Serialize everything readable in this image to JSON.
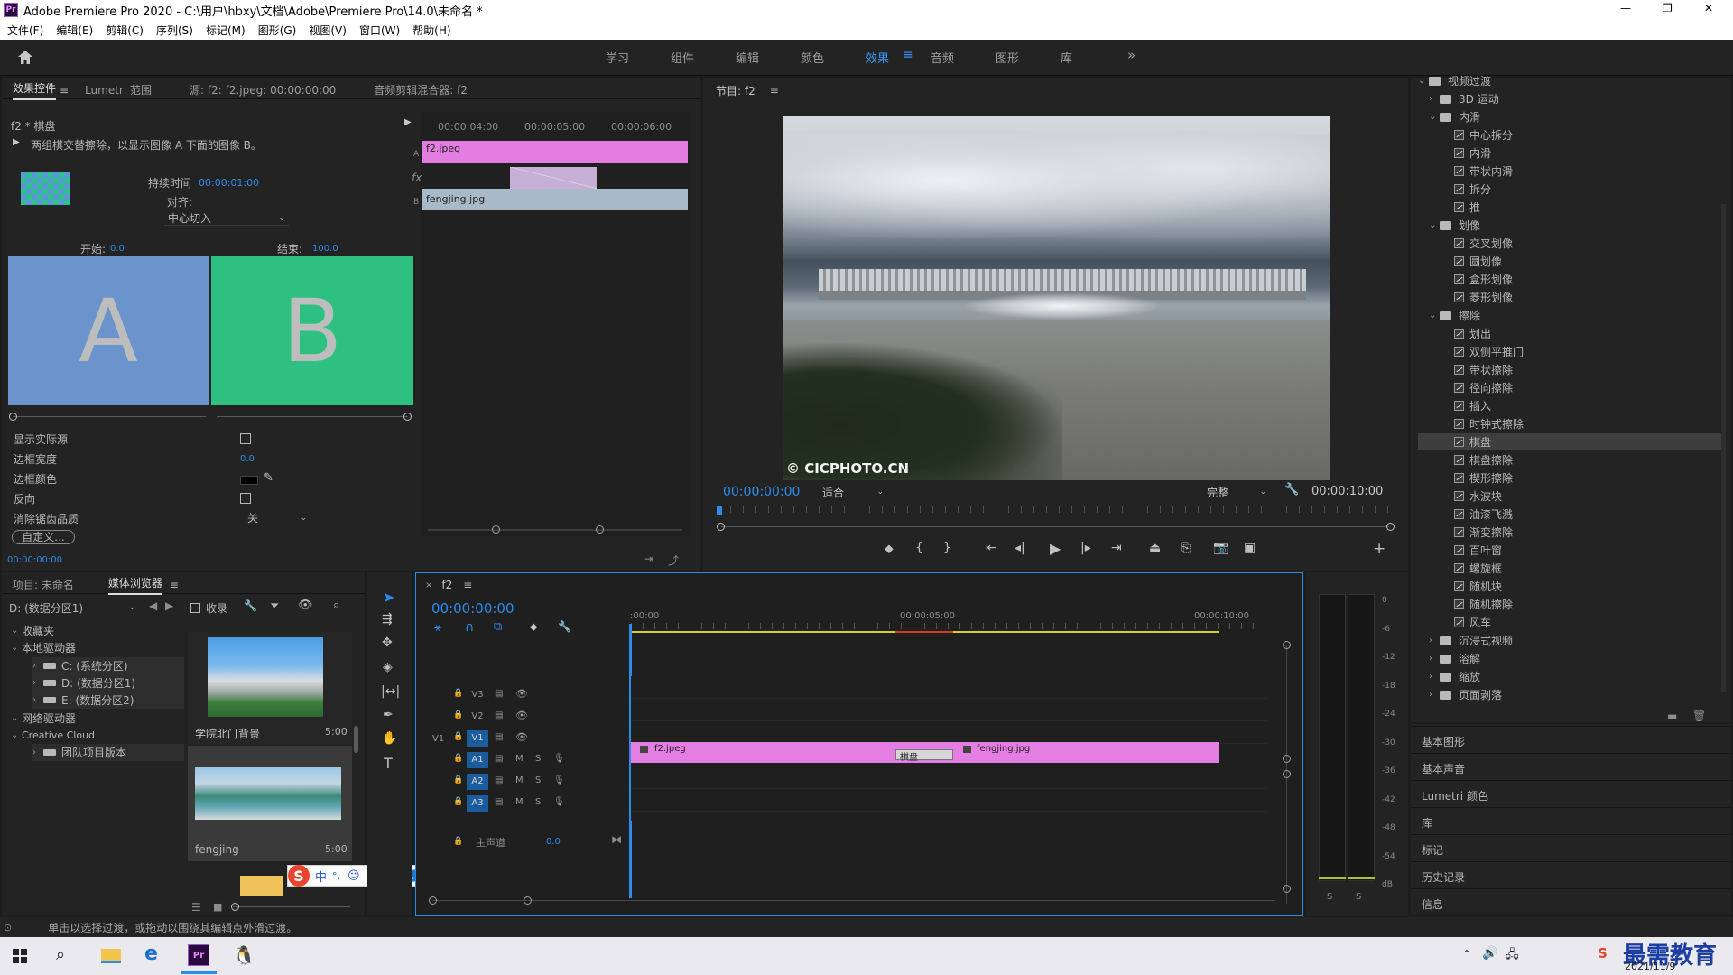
{
  "window": {
    "title": "Adobe Premiere Pro 2020 - C:\\用户\\hbxy\\文档\\Adobe\\Premiere Pro\\14.0\\未命名 *",
    "app_icon": "Pr",
    "controls": [
      "—",
      "❐",
      "✕"
    ]
  },
  "menu": [
    "文件(F)",
    "编辑(E)",
    "剪辑(C)",
    "序列(S)",
    "标记(M)",
    "图形(G)",
    "视图(V)",
    "窗口(W)",
    "帮助(H)"
  ],
  "workspaces": {
    "items": [
      "学习",
      "组件",
      "编辑",
      "颜色",
      "效果",
      "音频",
      "图形",
      "库"
    ],
    "active": "效果",
    "more": "»"
  },
  "effect_controls": {
    "tabs": [
      "效果控件",
      "Lumetri 范围",
      "源: f2: f2.jpeg: 00:00:00:00",
      "音频剪辑混合器: f2"
    ],
    "clip_label": "f2 * 棋盘",
    "description": "两组棋交替擦除，以显示图像 A 下面的图像 B。",
    "duration_label": "持续时间",
    "duration_value": "00:00:01:00",
    "align_label": "对齐:",
    "align_value": "中心切入",
    "start_label": "开始:",
    "start_value": "0.0",
    "end_label": "结束:",
    "end_value": "100.0",
    "preview_a": "A",
    "preview_b": "B",
    "props": [
      {
        "label": "显示实际源",
        "type": "checkbox"
      },
      {
        "label": "边框宽度",
        "value": "0.0"
      },
      {
        "label": "边框颜色",
        "type": "color"
      },
      {
        "label": "反向",
        "type": "checkbox"
      },
      {
        "label": "消除锯齿品质",
        "value": "关"
      }
    ],
    "custom_button": "自定义...",
    "timecode": "00:00:00:00",
    "mini_ruler": [
      "00:00:04:00",
      "00:00:05:00",
      "00:00:06:00"
    ],
    "clip_a": "f2.jpeg",
    "clip_b": "fengjing.jpg",
    "track_a": "A",
    "track_b": "B",
    "fx_label": "fx"
  },
  "program": {
    "title": "节目: f2",
    "watermark": "© CICPHOTO.CN",
    "timecode": "00:00:00:00",
    "fit": "适合",
    "quality": "完整",
    "duration": "00:00:10:00"
  },
  "effects": {
    "top_item": "视频过渡",
    "items": [
      {
        "label": "3D 运动",
        "kind": "folder",
        "indent": 1,
        "open": false
      },
      {
        "label": "内滑",
        "kind": "folder",
        "indent": 1,
        "open": true
      },
      {
        "label": "中心拆分",
        "kind": "fx",
        "indent": 2
      },
      {
        "label": "内滑",
        "kind": "fx",
        "indent": 2
      },
      {
        "label": "带状内滑",
        "kind": "fx",
        "indent": 2
      },
      {
        "label": "拆分",
        "kind": "fx",
        "indent": 2
      },
      {
        "label": "推",
        "kind": "fx",
        "indent": 2
      },
      {
        "label": "划像",
        "kind": "folder",
        "indent": 1,
        "open": true
      },
      {
        "label": "交叉划像",
        "kind": "fx",
        "indent": 2
      },
      {
        "label": "圆划像",
        "kind": "fx",
        "indent": 2
      },
      {
        "label": "盒形划像",
        "kind": "fx",
        "indent": 2
      },
      {
        "label": "菱形划像",
        "kind": "fx",
        "indent": 2
      },
      {
        "label": "擦除",
        "kind": "folder",
        "indent": 1,
        "open": true
      },
      {
        "label": "划出",
        "kind": "fx",
        "indent": 2
      },
      {
        "label": "双侧平推门",
        "kind": "fx",
        "indent": 2
      },
      {
        "label": "带状擦除",
        "kind": "fx",
        "indent": 2
      },
      {
        "label": "径向擦除",
        "kind": "fx",
        "indent": 2
      },
      {
        "label": "插入",
        "kind": "fx",
        "indent": 2
      },
      {
        "label": "时钟式擦除",
        "kind": "fx",
        "indent": 2
      },
      {
        "label": "棋盘",
        "kind": "fx",
        "indent": 2,
        "selected": true
      },
      {
        "label": "棋盘擦除",
        "kind": "fx",
        "indent": 2
      },
      {
        "label": "楔形擦除",
        "kind": "fx",
        "indent": 2
      },
      {
        "label": "水波块",
        "kind": "fx",
        "indent": 2
      },
      {
        "label": "油漆飞溅",
        "kind": "fx",
        "indent": 2
      },
      {
        "label": "渐变擦除",
        "kind": "fx",
        "indent": 2
      },
      {
        "label": "百叶窗",
        "kind": "fx",
        "indent": 2
      },
      {
        "label": "螺旋框",
        "kind": "fx",
        "indent": 2
      },
      {
        "label": "随机块",
        "kind": "fx",
        "indent": 2
      },
      {
        "label": "随机擦除",
        "kind": "fx",
        "indent": 2
      },
      {
        "label": "风车",
        "kind": "fx",
        "indent": 2
      },
      {
        "label": "沉浸式视频",
        "kind": "folder",
        "indent": 1,
        "open": false
      },
      {
        "label": "溶解",
        "kind": "folder",
        "indent": 1,
        "open": false
      },
      {
        "label": "缩放",
        "kind": "folder",
        "indent": 1,
        "open": false
      },
      {
        "label": "页面剥落",
        "kind": "folder",
        "indent": 1,
        "open": false
      }
    ],
    "collapsed_panels": [
      "基本图形",
      "基本声音",
      "Lumetri 颜色",
      "库",
      "标记",
      "历史记录",
      "信息"
    ]
  },
  "media_browser": {
    "tabs": [
      "项目: 未命名",
      "媒体浏览器"
    ],
    "drive": "D: (数据分区1)",
    "ingest": "收录",
    "tree": [
      {
        "label": "收藏夹",
        "indent": 0
      },
      {
        "label": "本地驱动器",
        "indent": 0
      },
      {
        "label": "C: (系统分区)",
        "indent": 2
      },
      {
        "label": "D: (数据分区1)",
        "indent": 2
      },
      {
        "label": "E: (数据分区2)",
        "indent": 2
      },
      {
        "label": "网络驱动器",
        "indent": 0
      },
      {
        "label": "Creative Cloud",
        "indent": 0
      },
      {
        "label": "团队项目版本",
        "indent": 2
      }
    ],
    "thumbs": [
      {
        "name": "学院北门背景",
        "duration": "5:00"
      },
      {
        "name": "fengjing",
        "duration": "5:00"
      }
    ]
  },
  "timeline": {
    "title": "f2",
    "timecode": "00:00:00:00",
    "ruler": [
      ":00:00",
      "00:00:05:00",
      "00:00:10:00"
    ],
    "video_tracks": [
      "V3",
      "V2",
      "V1"
    ],
    "audio_tracks": [
      "A1",
      "A2",
      "A3"
    ],
    "source_v": "V1",
    "master": "主声道",
    "master_value": "0.0",
    "clip1": "f2.jpeg",
    "clip2": "fengjing.jpg",
    "transition": "棋盘",
    "ms": [
      "M",
      "S"
    ]
  },
  "meter": {
    "scale": [
      "0",
      "-6",
      "-12",
      "-18",
      "-24",
      "-30",
      "-36",
      "-42",
      "-48",
      "-54",
      "dB"
    ],
    "solo": [
      "S",
      "S"
    ]
  },
  "status": "单击以选择过渡，或拖动以围绕其编辑点外滑过渡。",
  "ime": [
    "中",
    "°,",
    "☺",
    "🎤",
    "⌨",
    "👤",
    "👕",
    "▦"
  ],
  "taskbar": {
    "clock": "2021/11/9",
    "watermark": "最需教育"
  }
}
